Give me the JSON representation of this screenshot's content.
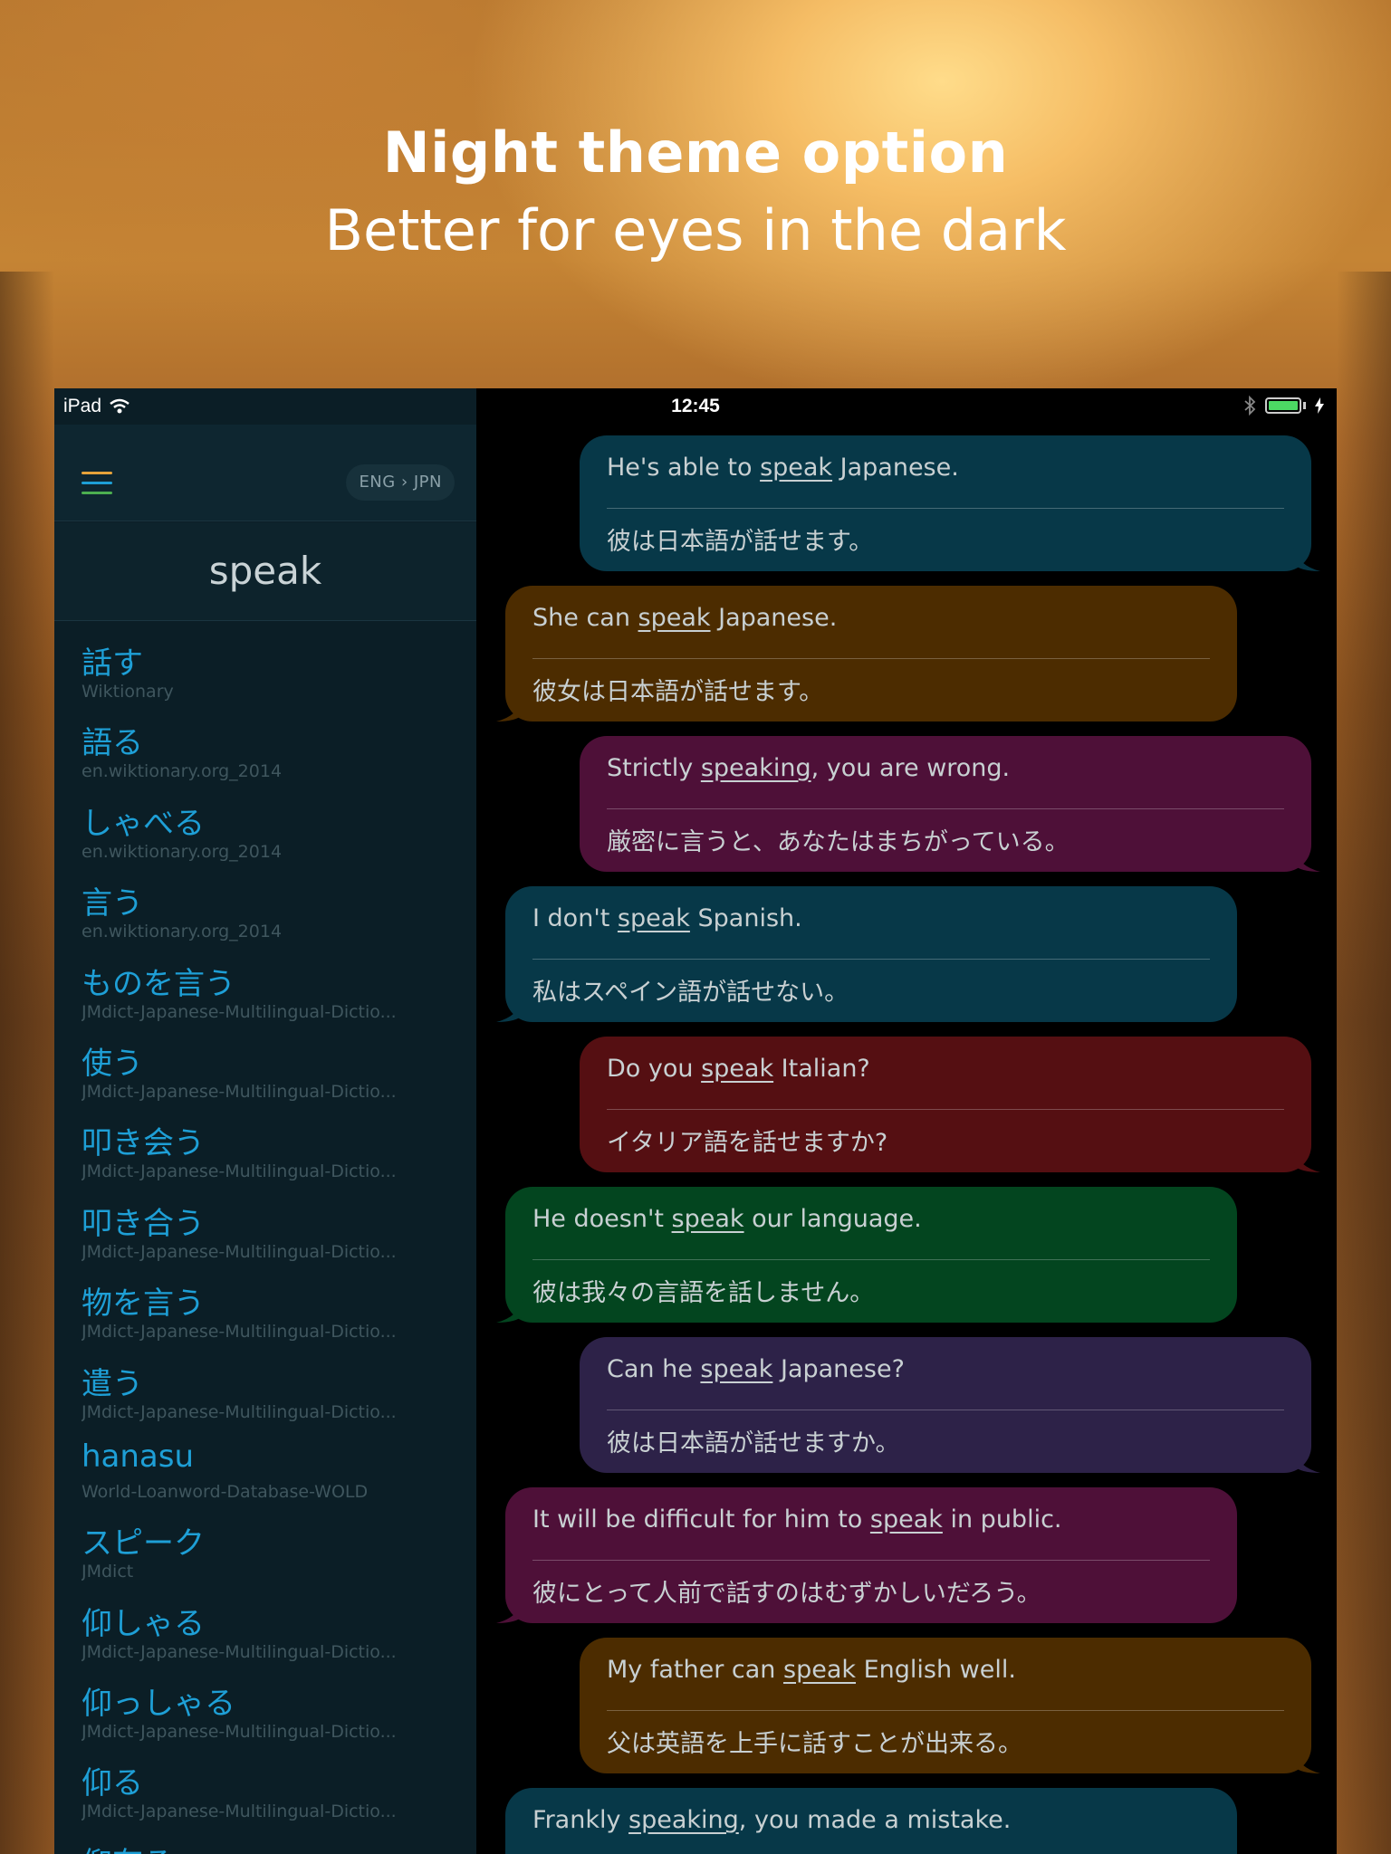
{
  "promo": {
    "headline": "Night theme option",
    "subline": "Better for eyes in the dark"
  },
  "status_bar": {
    "device": "iPad",
    "time": "12:45",
    "battery_level": 1.0
  },
  "sidebar": {
    "lang_pair": "ENG › JPN",
    "search_term": "speak",
    "results": [
      {
        "term": "話す",
        "source": "Wiktionary"
      },
      {
        "term": "語る",
        "source": "en.wiktionary.org_2014"
      },
      {
        "term": "しゃべる",
        "source": "en.wiktionary.org_2014"
      },
      {
        "term": "言う",
        "source": "en.wiktionary.org_2014"
      },
      {
        "term": "ものを言う",
        "source": "JMdict-Japanese-Multilingual-Dictio..."
      },
      {
        "term": "使う",
        "source": "JMdict-Japanese-Multilingual-Dictio..."
      },
      {
        "term": "叩き会う",
        "source": "JMdict-Japanese-Multilingual-Dictio..."
      },
      {
        "term": "叩き合う",
        "source": "JMdict-Japanese-Multilingual-Dictio..."
      },
      {
        "term": "物を言う",
        "source": "JMdict-Japanese-Multilingual-Dictio..."
      },
      {
        "term": "遣う",
        "source": "JMdict-Japanese-Multilingual-Dictio..."
      },
      {
        "term": "hanasu",
        "source": "World-Loanword-Database-WOLD"
      },
      {
        "term": "スピーク",
        "source": "JMdict"
      },
      {
        "term": "仰しゃる",
        "source": "JMdict-Japanese-Multilingual-Dictio..."
      },
      {
        "term": "仰っしゃる",
        "source": "JMdict-Japanese-Multilingual-Dictio..."
      },
      {
        "term": "仰る",
        "source": "JMdict-Japanese-Multilingual-Dictio..."
      },
      {
        "term": "仰有る",
        "source": ""
      }
    ]
  },
  "examples": [
    {
      "en_pre": "He's able to ",
      "en_kw": "speak",
      "en_post": " Japanese.",
      "jp": "彼は日本語が話せます。",
      "color": "#073848",
      "side": "right"
    },
    {
      "en_pre": "She can ",
      "en_kw": "speak",
      "en_post": " Japanese.",
      "jp": "彼女は日本語が話せます。",
      "color": "#4c2c00",
      "side": "left"
    },
    {
      "en_pre": "Strictly ",
      "en_kw": "speaking",
      "en_post": ", you are wrong.",
      "jp": "厳密に言うと、あなたはまちがっている。",
      "color": "#4e1038",
      "side": "right"
    },
    {
      "en_pre": "I don't ",
      "en_kw": "speak",
      "en_post": " Spanish.",
      "jp": "私はスペイン語が話せない。",
      "color": "#073848",
      "side": "left"
    },
    {
      "en_pre": "Do you ",
      "en_kw": "speak",
      "en_post": " Italian?",
      "jp": "イタリア語を話せますか?",
      "color": "#550f12",
      "side": "right"
    },
    {
      "en_pre": "He doesn't ",
      "en_kw": "speak",
      "en_post": " our language.",
      "jp": "彼は我々の言語を話しません。",
      "color": "#03451f",
      "side": "left"
    },
    {
      "en_pre": "Can he ",
      "en_kw": "speak",
      "en_post": " Japanese?",
      "jp": "彼は日本語が話せますか。",
      "color": "#2d2248",
      "side": "right"
    },
    {
      "en_pre": "It will be difficult for him to ",
      "en_kw": "speak",
      "en_post": " in public.",
      "jp": "彼にとって人前で話すのはむずかしいだろう。",
      "color": "#4e1038",
      "side": "left"
    },
    {
      "en_pre": "My father can ",
      "en_kw": "speak",
      "en_post": " English well.",
      "jp": "父は英語を上手に話すことが出来る。",
      "color": "#4c2c00",
      "side": "right"
    },
    {
      "en_pre": "Frankly ",
      "en_kw": "speaking",
      "en_post": ", you made a mistake.",
      "jp": "",
      "color": "#073848",
      "side": "left"
    }
  ],
  "colors": {
    "sidebar_bg": "#0b1e26",
    "result_term": "#1e9fd6",
    "result_source": "#3f565e",
    "menu_lines": [
      "#e6a33a",
      "#1e9fd6",
      "#4caf50"
    ]
  },
  "icons": [
    "wifi-icon",
    "bluetooth-icon",
    "battery-icon",
    "charging-bolt-icon",
    "menu-icon"
  ]
}
